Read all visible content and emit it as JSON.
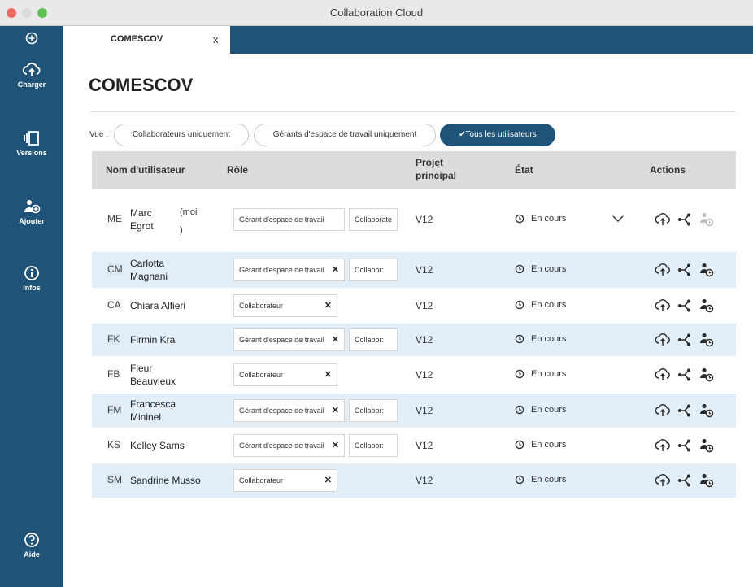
{
  "window": {
    "title": "Collaboration Cloud"
  },
  "sidebar": {
    "items": [
      {
        "label": "",
        "icon": "plus-circle-icon"
      },
      {
        "label": "Charger",
        "icon": "cloud-upload-icon"
      },
      {
        "label": "Versions",
        "icon": "versions-icon"
      },
      {
        "label": "Ajouter",
        "icon": "add-user-icon"
      },
      {
        "label": "Infos",
        "icon": "info-icon"
      },
      {
        "label": "Aide",
        "icon": "help-icon"
      }
    ]
  },
  "tab": {
    "label": "COMESCOV",
    "close": "x"
  },
  "page": {
    "title": "COMESCOV"
  },
  "filter": {
    "label": "Vue :",
    "options": [
      {
        "label": "Collaborateurs uniquement",
        "active": false
      },
      {
        "label": "Gérants d'espace de travail uniquement",
        "active": false
      },
      {
        "label": "✔Tous les utilisateurs",
        "active": true
      }
    ]
  },
  "table": {
    "headers": {
      "user": "Nom d'utilisateur",
      "role": "Rôle",
      "project": "Projet\nprincipal",
      "state": "État",
      "actions": "Actions"
    },
    "rows": [
      {
        "initials": "ME",
        "name": "Marc\nEgrot",
        "moi": "(moi\n)",
        "roles": [
          "Gérant d'espace de travail",
          "Collaborate"
        ],
        "project": "V12",
        "state": "En cours"
      },
      {
        "initials": "CM",
        "name": "Carlotta\nMagnani",
        "roles": [
          "Gérant d'espace de travail",
          "Collabor:"
        ],
        "project": "V12",
        "state": "En cours"
      },
      {
        "initials": "CA",
        "name": "Chiara Alfieri",
        "roles": [
          "Collaborateur"
        ],
        "project": "V12",
        "state": "En cours"
      },
      {
        "initials": "FK",
        "name": "Firmin Kra",
        "roles": [
          "Gérant d'espace de travail",
          "Collabor:"
        ],
        "project": "V12",
        "state": "En cours"
      },
      {
        "initials": "FB",
        "name": "Fleur\nBeauvieux",
        "roles": [
          "Collaborateur"
        ],
        "project": "V12",
        "state": "En cours"
      },
      {
        "initials": "FM",
        "name": "Francesca\nMininel",
        "roles": [
          "Gérant d'espace de travail",
          "Collabor:"
        ],
        "project": "V12",
        "state": "En cours"
      },
      {
        "initials": "KS",
        "name": "Kelley Sams",
        "roles": [
          "Gérant d'espace de travail",
          "Collabor:"
        ],
        "project": "V12",
        "state": "En cours"
      },
      {
        "initials": "SM",
        "name": "Sandrine Musso",
        "roles": [
          "Collaborateur"
        ],
        "project": "V12",
        "state": "En cours"
      }
    ]
  },
  "colors": {
    "brand": "#1f5478",
    "row_alt": "#e2eef8",
    "header_bg": "#dcdcdc"
  }
}
